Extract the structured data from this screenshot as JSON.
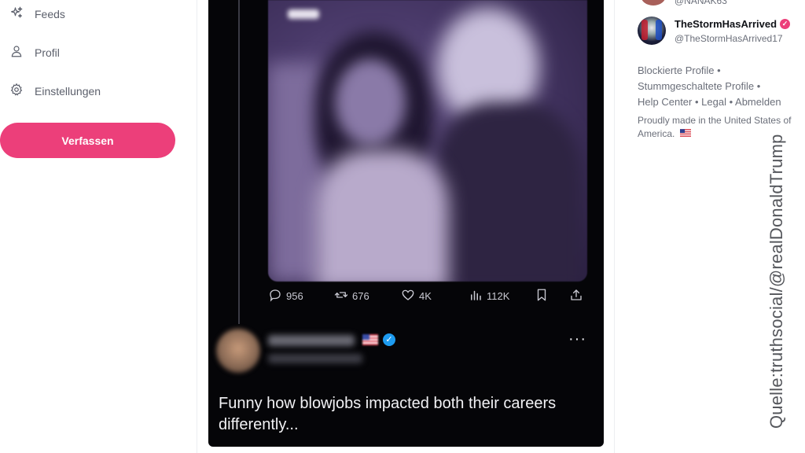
{
  "sidebar": {
    "items": [
      {
        "label": "Feeds",
        "icon": "sparkles-icon"
      },
      {
        "label": "Profil",
        "icon": "user-icon"
      },
      {
        "label": "Einstellungen",
        "icon": "gear-icon"
      }
    ],
    "compose_label": "Verfassen"
  },
  "post": {
    "stats": {
      "replies": "956",
      "reposts": "676",
      "likes": "4K",
      "views": "112K"
    },
    "text": "Funny how blowjobs impacted both their careers differently..."
  },
  "right": {
    "top_partial_handle": "@NANAK63",
    "follow": {
      "name": "TheStormHasArrived",
      "handle": "@TheStormHasArrived17"
    },
    "footer_links": {
      "blocked": "Blockierte Profile",
      "muted": "Stummgeschaltete Profile",
      "help": "Help Center",
      "legal": "Legal",
      "logout": "Abmelden"
    },
    "made_in": "Proudly made in the United States of America."
  },
  "source_credit": "Quelle:truthsocial/@realDonaldTrump",
  "colors": {
    "accent": "#ec3f7a",
    "verified_blue": "#1d9bf0",
    "media_bg": "#050508"
  }
}
